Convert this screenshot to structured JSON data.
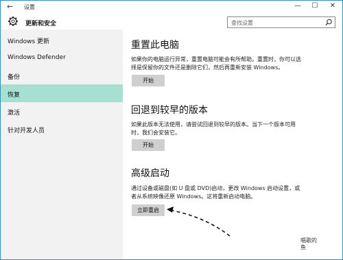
{
  "window": {
    "title": "设置",
    "back_icon": "←",
    "minimize_icon": "—",
    "maximize_icon": "☐",
    "close_icon": "✕"
  },
  "header": {
    "title": "更新和安全",
    "search_placeholder": "查找设置"
  },
  "sidebar": {
    "items": [
      {
        "label": "Windows 更新"
      },
      {
        "label": "Windows Defender"
      },
      {
        "label": "备份"
      },
      {
        "label": "恢复"
      },
      {
        "label": "激活"
      },
      {
        "label": "针对开发人员"
      }
    ],
    "active_color": "#a7e0d1"
  },
  "sections": [
    {
      "title": "重置此电脑",
      "desc": "如果你的电脑运行异常，重置电脑可能会有所帮助。重置时，你可以选择是保留你的文件还是删除它们，然后再重新安装 Windows。",
      "button": "开始"
    },
    {
      "title": "回退到较早的版本",
      "desc": "如果此版本无法使用，请尝试回退到较早的版本。当下一个版本可用时，我们会安装它。",
      "button": "开始"
    },
    {
      "title": "高级启动",
      "desc": "通过设备或磁盘(如 U 盘或 DVD)启动，更改 Windows 启动设置，或者从系统映像还原 Windows。这将重新启动电脑。",
      "button": "立即重启"
    }
  ],
  "watermark": "唱歌的鱼"
}
